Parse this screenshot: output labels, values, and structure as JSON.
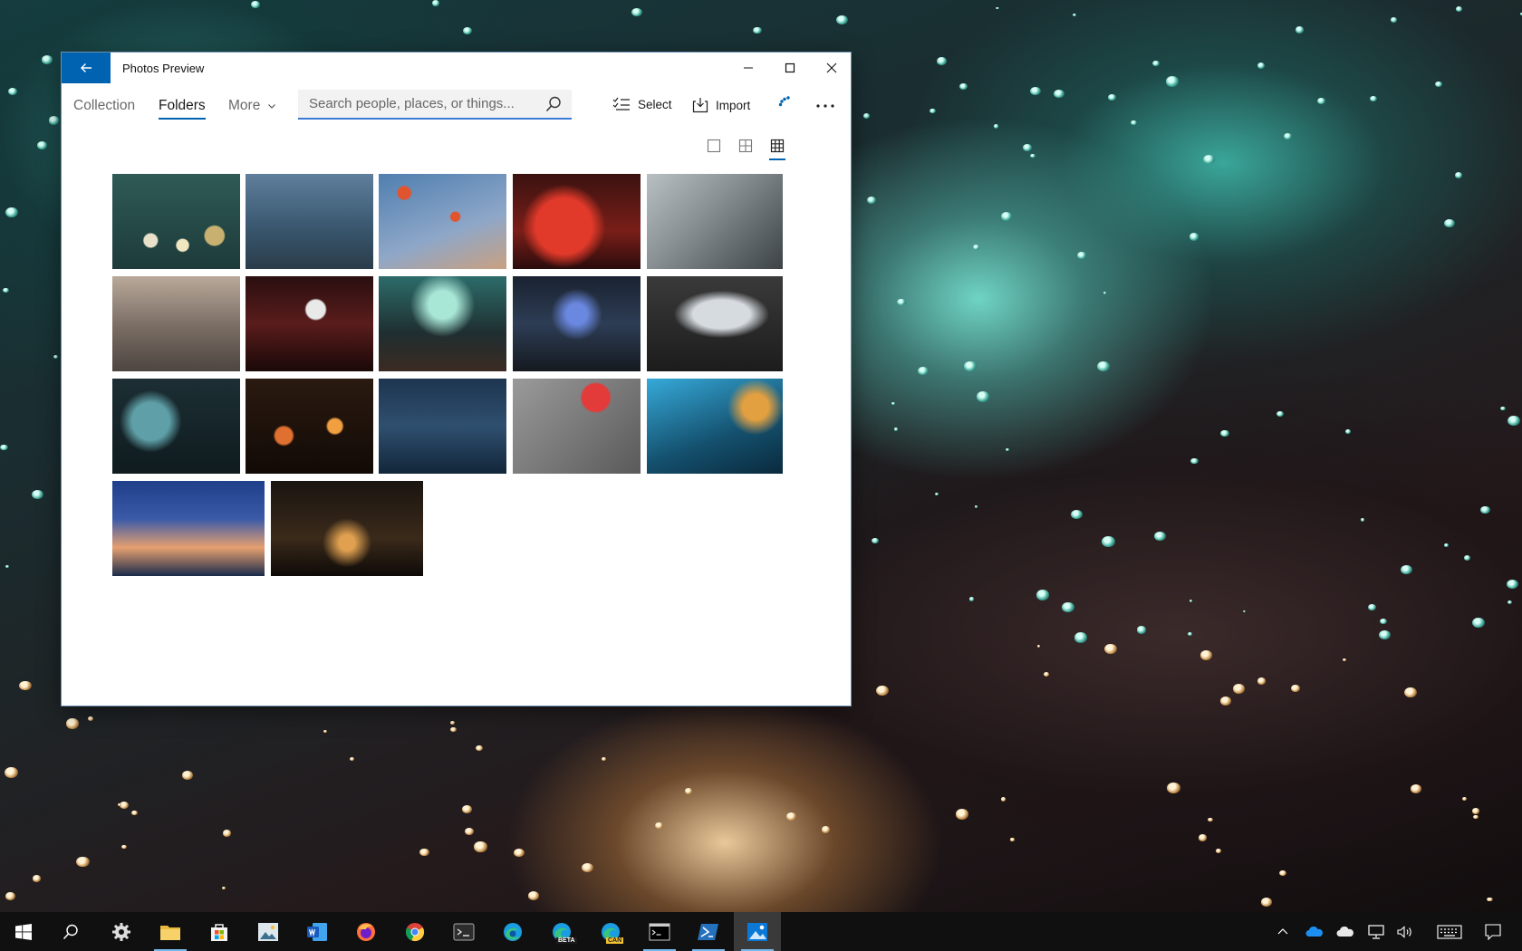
{
  "window": {
    "title": "Photos Preview"
  },
  "nav": {
    "tabs": [
      {
        "label": "Collection"
      },
      {
        "label": "Folders"
      },
      {
        "label": "More"
      }
    ],
    "active_tab": "Folders"
  },
  "search": {
    "placeholder": "Search people, places, or things...",
    "value": ""
  },
  "toolbar": {
    "select_label": "Select",
    "import_label": "Import",
    "more_options": "..."
  },
  "view_sizes": {
    "options": [
      "large",
      "medium",
      "small"
    ],
    "selected": "small"
  },
  "photos": [
    {
      "subject": "rain drops bokeh window"
    },
    {
      "subject": "bridge in rain"
    },
    {
      "subject": "people with umbrellas crossing"
    },
    {
      "subject": "red lights through rainy glass"
    },
    {
      "subject": "umbrella edge wet street"
    },
    {
      "subject": "rainy european street"
    },
    {
      "subject": "woman with umbrella at night"
    },
    {
      "subject": "rainy city windshield"
    },
    {
      "subject": "city street at night"
    },
    {
      "subject": "puddle reflection cobblestones"
    },
    {
      "subject": "heart drawn on foggy glass"
    },
    {
      "subject": "colorful bokeh rain drops"
    },
    {
      "subject": "brandenburg gate reflection"
    },
    {
      "subject": "red umbrella from above"
    },
    {
      "subject": "person with umbrella blue light"
    },
    {
      "subject": "city skyline through rainy window"
    },
    {
      "subject": "dark alley at night"
    }
  ],
  "taskbar": {
    "apps": [
      {
        "icon": "windows-start-icon"
      },
      {
        "icon": "search-icon"
      },
      {
        "icon": "settings-gear-icon"
      },
      {
        "icon": "file-explorer-icon"
      },
      {
        "icon": "microsoft-store-icon"
      },
      {
        "icon": "photos-legacy-icon"
      },
      {
        "icon": "word-icon"
      },
      {
        "icon": "firefox-icon"
      },
      {
        "icon": "chrome-icon"
      },
      {
        "icon": "terminal-icon"
      },
      {
        "icon": "edge-icon"
      },
      {
        "icon": "edge-beta-icon"
      },
      {
        "icon": "edge-canary-icon"
      },
      {
        "icon": "command-prompt-icon"
      },
      {
        "icon": "powershell-icon"
      },
      {
        "icon": "photos-icon"
      }
    ],
    "edge_beta_badge": "BETA",
    "edge_canary_badge": "CAN",
    "tray": [
      {
        "icon": "chevron-up-icon"
      },
      {
        "icon": "onedrive-icon"
      },
      {
        "icon": "onedrive-personal-icon"
      },
      {
        "icon": "network-icon"
      },
      {
        "icon": "volume-icon"
      },
      {
        "icon": "touch-keyboard-icon"
      },
      {
        "icon": "notifications-icon"
      }
    ]
  },
  "colors": {
    "accent": "#0063b1",
    "taskbar": "#101010",
    "window_bg": "#ffffff"
  }
}
